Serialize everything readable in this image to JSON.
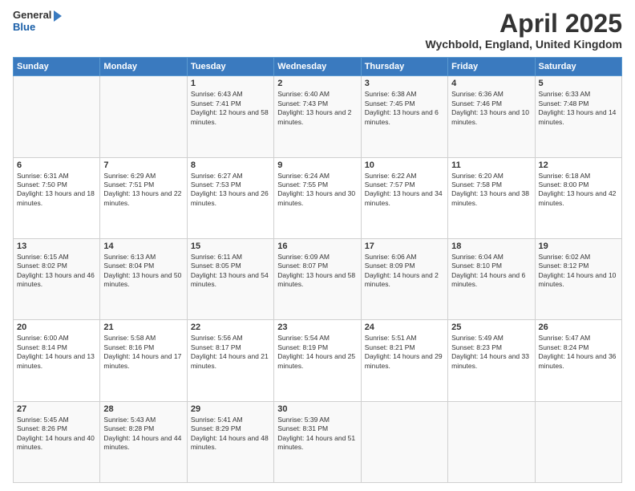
{
  "header": {
    "logo_line1": "General",
    "logo_line2": "Blue",
    "main_title": "April 2025",
    "subtitle": "Wychbold, England, United Kingdom"
  },
  "days_of_week": [
    "Sunday",
    "Monday",
    "Tuesday",
    "Wednesday",
    "Thursday",
    "Friday",
    "Saturday"
  ],
  "weeks": [
    [
      {
        "day": "",
        "info": ""
      },
      {
        "day": "",
        "info": ""
      },
      {
        "day": "1",
        "info": "Sunrise: 6:43 AM\nSunset: 7:41 PM\nDaylight: 12 hours and 58 minutes."
      },
      {
        "day": "2",
        "info": "Sunrise: 6:40 AM\nSunset: 7:43 PM\nDaylight: 13 hours and 2 minutes."
      },
      {
        "day": "3",
        "info": "Sunrise: 6:38 AM\nSunset: 7:45 PM\nDaylight: 13 hours and 6 minutes."
      },
      {
        "day": "4",
        "info": "Sunrise: 6:36 AM\nSunset: 7:46 PM\nDaylight: 13 hours and 10 minutes."
      },
      {
        "day": "5",
        "info": "Sunrise: 6:33 AM\nSunset: 7:48 PM\nDaylight: 13 hours and 14 minutes."
      }
    ],
    [
      {
        "day": "6",
        "info": "Sunrise: 6:31 AM\nSunset: 7:50 PM\nDaylight: 13 hours and 18 minutes."
      },
      {
        "day": "7",
        "info": "Sunrise: 6:29 AM\nSunset: 7:51 PM\nDaylight: 13 hours and 22 minutes."
      },
      {
        "day": "8",
        "info": "Sunrise: 6:27 AM\nSunset: 7:53 PM\nDaylight: 13 hours and 26 minutes."
      },
      {
        "day": "9",
        "info": "Sunrise: 6:24 AM\nSunset: 7:55 PM\nDaylight: 13 hours and 30 minutes."
      },
      {
        "day": "10",
        "info": "Sunrise: 6:22 AM\nSunset: 7:57 PM\nDaylight: 13 hours and 34 minutes."
      },
      {
        "day": "11",
        "info": "Sunrise: 6:20 AM\nSunset: 7:58 PM\nDaylight: 13 hours and 38 minutes."
      },
      {
        "day": "12",
        "info": "Sunrise: 6:18 AM\nSunset: 8:00 PM\nDaylight: 13 hours and 42 minutes."
      }
    ],
    [
      {
        "day": "13",
        "info": "Sunrise: 6:15 AM\nSunset: 8:02 PM\nDaylight: 13 hours and 46 minutes."
      },
      {
        "day": "14",
        "info": "Sunrise: 6:13 AM\nSunset: 8:04 PM\nDaylight: 13 hours and 50 minutes."
      },
      {
        "day": "15",
        "info": "Sunrise: 6:11 AM\nSunset: 8:05 PM\nDaylight: 13 hours and 54 minutes."
      },
      {
        "day": "16",
        "info": "Sunrise: 6:09 AM\nSunset: 8:07 PM\nDaylight: 13 hours and 58 minutes."
      },
      {
        "day": "17",
        "info": "Sunrise: 6:06 AM\nSunset: 8:09 PM\nDaylight: 14 hours and 2 minutes."
      },
      {
        "day": "18",
        "info": "Sunrise: 6:04 AM\nSunset: 8:10 PM\nDaylight: 14 hours and 6 minutes."
      },
      {
        "day": "19",
        "info": "Sunrise: 6:02 AM\nSunset: 8:12 PM\nDaylight: 14 hours and 10 minutes."
      }
    ],
    [
      {
        "day": "20",
        "info": "Sunrise: 6:00 AM\nSunset: 8:14 PM\nDaylight: 14 hours and 13 minutes."
      },
      {
        "day": "21",
        "info": "Sunrise: 5:58 AM\nSunset: 8:16 PM\nDaylight: 14 hours and 17 minutes."
      },
      {
        "day": "22",
        "info": "Sunrise: 5:56 AM\nSunset: 8:17 PM\nDaylight: 14 hours and 21 minutes."
      },
      {
        "day": "23",
        "info": "Sunrise: 5:54 AM\nSunset: 8:19 PM\nDaylight: 14 hours and 25 minutes."
      },
      {
        "day": "24",
        "info": "Sunrise: 5:51 AM\nSunset: 8:21 PM\nDaylight: 14 hours and 29 minutes."
      },
      {
        "day": "25",
        "info": "Sunrise: 5:49 AM\nSunset: 8:23 PM\nDaylight: 14 hours and 33 minutes."
      },
      {
        "day": "26",
        "info": "Sunrise: 5:47 AM\nSunset: 8:24 PM\nDaylight: 14 hours and 36 minutes."
      }
    ],
    [
      {
        "day": "27",
        "info": "Sunrise: 5:45 AM\nSunset: 8:26 PM\nDaylight: 14 hours and 40 minutes."
      },
      {
        "day": "28",
        "info": "Sunrise: 5:43 AM\nSunset: 8:28 PM\nDaylight: 14 hours and 44 minutes."
      },
      {
        "day": "29",
        "info": "Sunrise: 5:41 AM\nSunset: 8:29 PM\nDaylight: 14 hours and 48 minutes."
      },
      {
        "day": "30",
        "info": "Sunrise: 5:39 AM\nSunset: 8:31 PM\nDaylight: 14 hours and 51 minutes."
      },
      {
        "day": "",
        "info": ""
      },
      {
        "day": "",
        "info": ""
      },
      {
        "day": "",
        "info": ""
      }
    ]
  ]
}
